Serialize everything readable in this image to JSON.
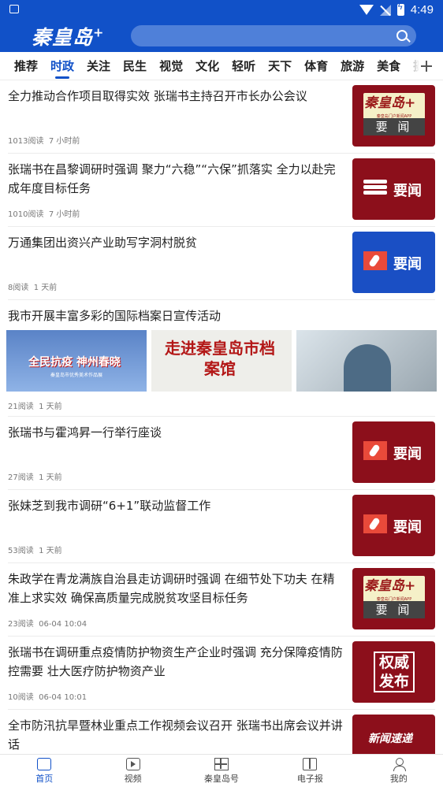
{
  "status_bar": {
    "time": "4:49"
  },
  "header": {
    "logo_text": "秦皇岛",
    "logo_plus": "+"
  },
  "tabs": [
    "推荐",
    "时政",
    "关注",
    "民生",
    "视觉",
    "文化",
    "轻听",
    "天下",
    "体育",
    "旅游",
    "美食",
    "摄"
  ],
  "active_tab_index": 1,
  "feed": [
    {
      "title": "全力推动合作项目取得实效 张瑞书主持召开市长办公会议",
      "reads": "1013阅读",
      "time": "7 小时前",
      "image": {
        "type": "logo-card",
        "brand": "秦皇岛",
        "plus": "+",
        "sub": "秦皇岛门户新闻APP",
        "label": "要 闻"
      }
    },
    {
      "title": "张瑞书在昌黎调研时强调 聚力“六稳”“六保”抓落实 全力以赴完成年度目标任务",
      "reads": "1010阅读",
      "time": "7 小时前",
      "image": {
        "type": "stack",
        "label": "要闻"
      }
    },
    {
      "title": "万通集团出资兴产业助写字洞村脱贫",
      "reads": "8阅读",
      "time": "1 天前",
      "image": {
        "type": "mic-blue",
        "label": "要闻"
      }
    },
    {
      "title": "我市开展丰富多彩的国际档案日宣传活动",
      "reads": "21阅读",
      "time": "1 天前",
      "gallery": {
        "img1_text": "全民抗疫 神州春晓",
        "img1_sub": "秦皇岛市优秀美术作品展",
        "img2_text": "走进秦皇岛市档案馆"
      }
    },
    {
      "title": "张瑞书与霍鸿昇一行举行座谈",
      "reads": "27阅读",
      "time": "1 天前",
      "image": {
        "type": "mic",
        "label": "要闻"
      }
    },
    {
      "title": "张妹芝到我市调研“6+1”联动监督工作",
      "reads": "53阅读",
      "time": "1 天前",
      "image": {
        "type": "mic",
        "label": "要闻"
      }
    },
    {
      "title": "朱政学在青龙满族自治县走访调研时强调 在细节处下功夫 在精准上求实效 确保高质量完成脱贫攻坚目标任务",
      "reads": "23阅读",
      "time": "06-04 10:04",
      "image": {
        "type": "logo-card",
        "brand": "秦皇岛",
        "plus": "+",
        "sub": "秦皇岛门户新闻APP",
        "label": "要 闻"
      }
    },
    {
      "title": "张瑞书在调研重点疫情防护物资生产企业时强调 充分保障疫情防控需要 壮大医疗防护物资产业",
      "reads": "10阅读",
      "time": "06-04 10:01",
      "image": {
        "type": "auth",
        "label": "权威 发布"
      }
    },
    {
      "title": "全市防汛抗旱暨林业重点工作视频会议召开 张瑞书出席会议并讲话",
      "reads": "",
      "time": "",
      "image": {
        "type": "quick",
        "label": "新闻速递"
      }
    }
  ],
  "colors": {
    "primary": "#1151c8",
    "news_red": "#8c0f1b",
    "news_blue": "#1a4fc4"
  },
  "tabbar": [
    {
      "label": "首页",
      "icon": "home-icon"
    },
    {
      "label": "视频",
      "icon": "video-icon"
    },
    {
      "label": "秦皇岛号",
      "icon": "grid-icon"
    },
    {
      "label": "电子报",
      "icon": "book-icon"
    },
    {
      "label": "我的",
      "icon": "user-icon"
    }
  ]
}
